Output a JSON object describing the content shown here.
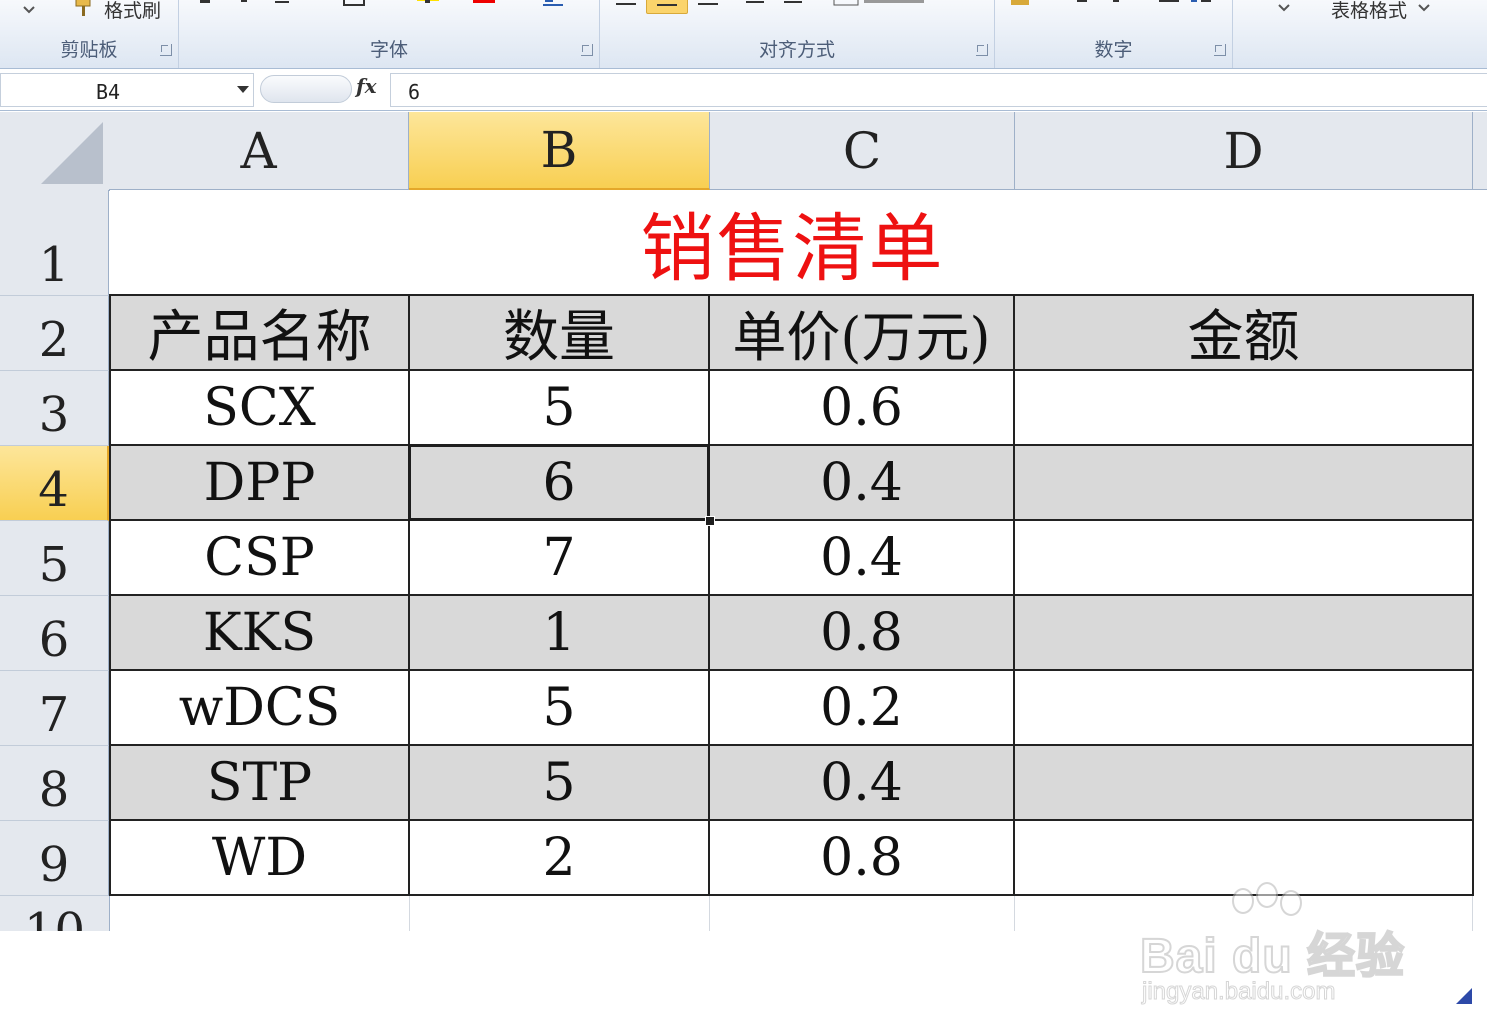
{
  "ribbon": {
    "groups": [
      {
        "label": "剪贴板",
        "top_text": "格式刷"
      },
      {
        "label": "字体"
      },
      {
        "label": "对齐方式"
      },
      {
        "label": "数字"
      },
      {
        "label": "",
        "top_text": "表格格式"
      }
    ]
  },
  "formula_bar": {
    "name_box": "B4",
    "fx": "fx",
    "formula": "6"
  },
  "columns": [
    "A",
    "B",
    "C",
    "D"
  ],
  "rows": [
    "1",
    "2",
    "3",
    "4",
    "5",
    "6",
    "7",
    "8",
    "9",
    "10"
  ],
  "sheet": {
    "title": "销售清单",
    "headers": [
      "产品名称",
      "数量",
      "单价(万元)",
      "金额"
    ],
    "data": [
      {
        "name": "SCX",
        "qty": "5",
        "price": "0.6",
        "amount": ""
      },
      {
        "name": "DPP",
        "qty": "6",
        "price": "0.4",
        "amount": ""
      },
      {
        "name": "CSP",
        "qty": "7",
        "price": "0.4",
        "amount": ""
      },
      {
        "name": "KKS",
        "qty": "1",
        "price": "0.8",
        "amount": ""
      },
      {
        "name": "wDCS",
        "qty": "5",
        "price": "0.2",
        "amount": ""
      },
      {
        "name": "STP",
        "qty": "5",
        "price": "0.4",
        "amount": ""
      },
      {
        "name": "WD",
        "qty": "2",
        "price": "0.8",
        "amount": ""
      }
    ]
  },
  "selected_cell": "B4",
  "watermark": {
    "main": "Bai du 经验",
    "sub": "jingyan.baidu.com"
  },
  "colors": {
    "title_red": "#ee1111",
    "selection_header": "#f8cf52",
    "band_gray": "#d9d9d9"
  }
}
